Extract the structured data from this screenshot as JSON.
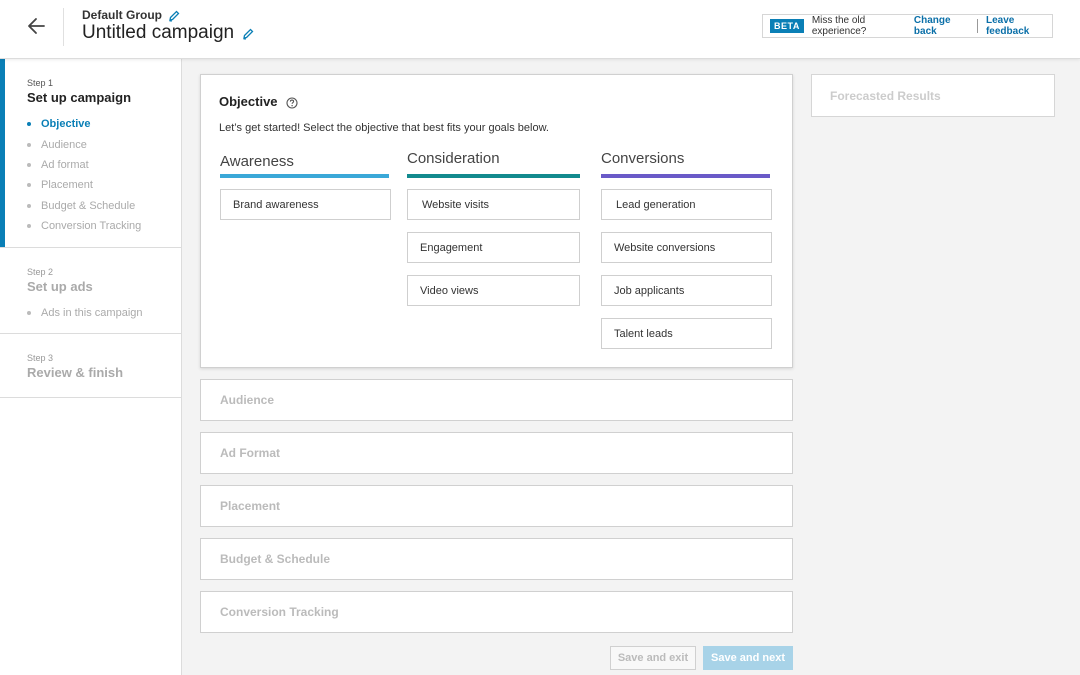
{
  "header": {
    "group_name": "Default Group",
    "campaign_title": "Untitled campaign",
    "beta_badge": "BETA",
    "beta_text": "Miss the old experience?",
    "change_back": "Change back",
    "leave_feedback": "Leave feedback"
  },
  "sidebar": {
    "steps": [
      {
        "label": "Step 1",
        "title": "Set up campaign",
        "items": [
          "Objective",
          "Audience",
          "Ad format",
          "Placement",
          "Budget & Schedule",
          "Conversion Tracking"
        ]
      },
      {
        "label": "Step 2",
        "title": "Set up ads",
        "items": [
          "Ads in this campaign"
        ]
      },
      {
        "label": "Step 3",
        "title": "Review & finish"
      }
    ]
  },
  "objective": {
    "title": "Objective",
    "description": "Let’s get started! Select the objective that best fits your goals below.",
    "columns": [
      {
        "heading": "Awareness",
        "color": "#3aa8d8",
        "options": [
          "Brand awareness"
        ]
      },
      {
        "heading": "Consideration",
        "color": "#128a8e",
        "options": [
          "Website visits",
          "Engagement",
          "Video views"
        ]
      },
      {
        "heading": "Conversions",
        "color": "#6a5ac8",
        "options": [
          "Lead generation",
          "Website conversions",
          "Job applicants",
          "Talent leads"
        ]
      }
    ]
  },
  "sections": [
    "Audience",
    "Ad Format",
    "Placement",
    "Budget & Schedule",
    "Conversion Tracking"
  ],
  "forecast": {
    "title": "Forecasted Results"
  },
  "buttons": {
    "save_exit": "Save and exit",
    "save_next": "Save and next"
  },
  "colors": {
    "accent": "#0a7fb6",
    "awareness": "#3aa8d8",
    "consideration": "#128a8e",
    "conversions": "#6a5ac8"
  }
}
